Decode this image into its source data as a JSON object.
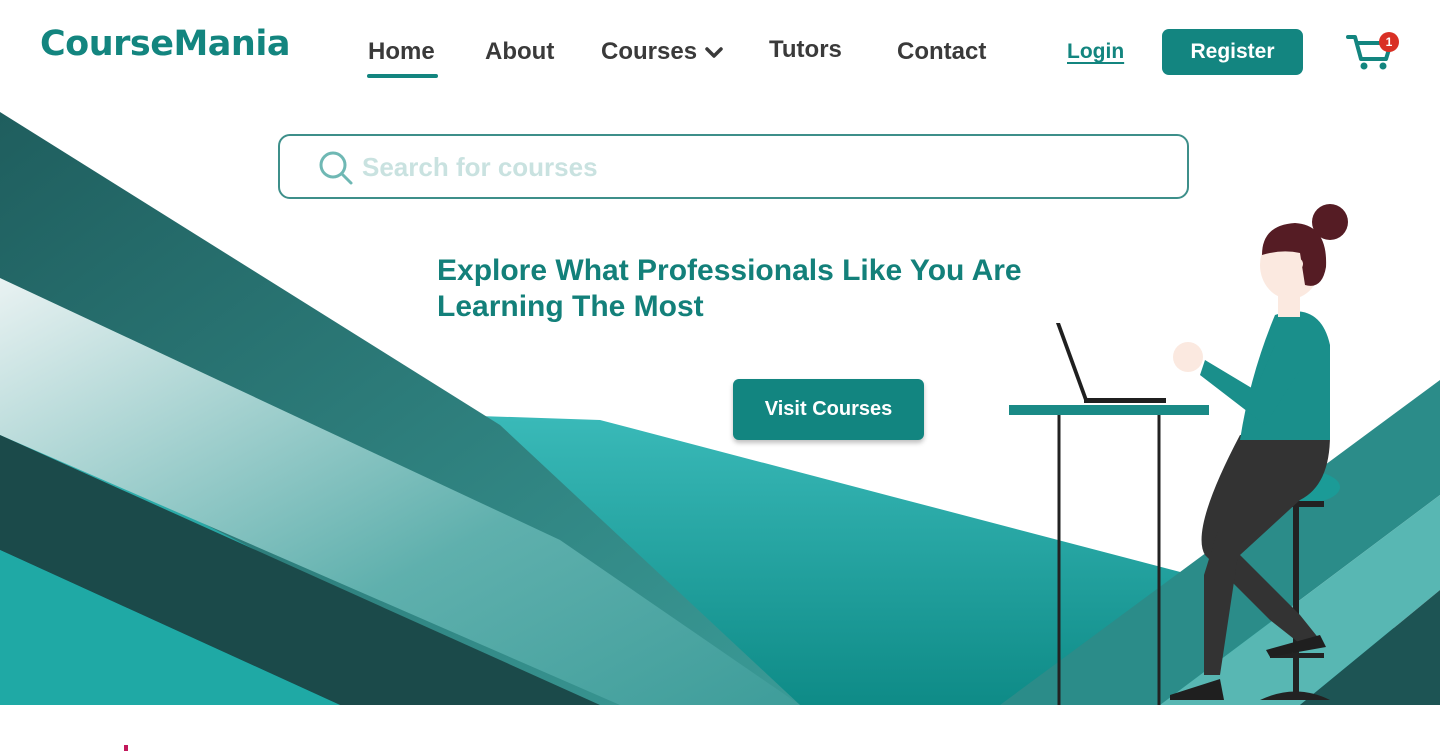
{
  "brand": {
    "name": "CourseMania",
    "color": "#13857f"
  },
  "nav": {
    "items": [
      {
        "label": "Home",
        "active": true
      },
      {
        "label": "About"
      },
      {
        "label": "Courses",
        "icon": "chevron-down-icon"
      },
      {
        "label": "Tutors"
      },
      {
        "label": "Contact"
      }
    ]
  },
  "auth": {
    "login_label": "Login",
    "register_label": "Register"
  },
  "cart": {
    "icon": "cart-icon",
    "count": "1"
  },
  "search": {
    "placeholder": "Search for courses",
    "value": "",
    "icon": "search-icon"
  },
  "hero": {
    "headline": "Explore What Professionals Like You Are Learning The Most",
    "cta_label": "Visit Courses"
  },
  "colors": {
    "primary": "#13857f",
    "dark_teal": "#1b4a4a",
    "light_teal": "#3bbcbc",
    "badge": "#d93025"
  }
}
